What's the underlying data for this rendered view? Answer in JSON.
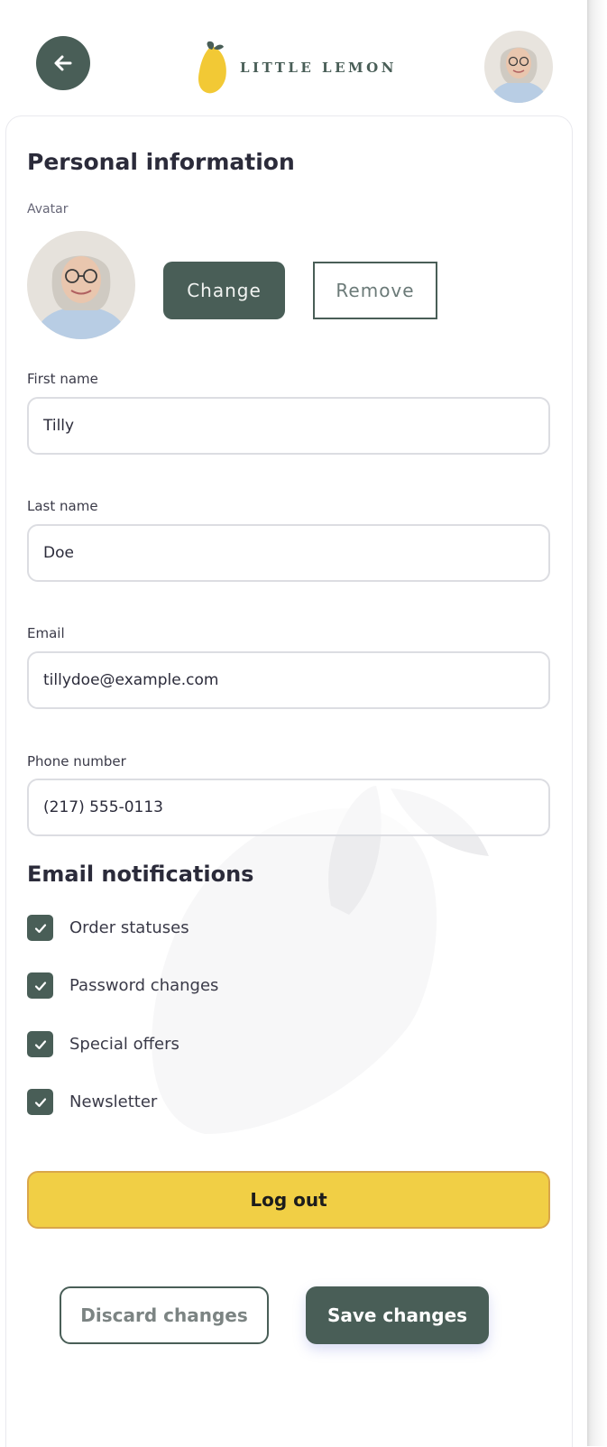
{
  "header": {
    "brand_name": "LITTLE LEMON",
    "back_icon": "arrow-left-icon",
    "avatar_icon": "user-photo"
  },
  "personal": {
    "title": "Personal information",
    "avatar_label": "Avatar",
    "change_label": "Change",
    "remove_label": "Remove"
  },
  "fields": {
    "first_name": {
      "label": "First name",
      "value": "Tilly"
    },
    "last_name": {
      "label": "Last name",
      "value": "Doe"
    },
    "email": {
      "label": "Email",
      "value": "tillydoe@example.com"
    },
    "phone": {
      "label": "Phone number",
      "value": "(217) 555-0113"
    }
  },
  "notifications": {
    "title": "Email notifications",
    "items": [
      {
        "label": "Order statuses",
        "checked": true
      },
      {
        "label": "Password changes",
        "checked": true
      },
      {
        "label": "Special offers",
        "checked": true
      },
      {
        "label": "Newsletter",
        "checked": true
      }
    ]
  },
  "actions": {
    "logout_label": "Log out",
    "discard_label": "Discard changes",
    "save_label": "Save changes"
  },
  "colors": {
    "primary": "#495e57",
    "accent": "#f1cf45",
    "text": "#2b2b3a"
  }
}
